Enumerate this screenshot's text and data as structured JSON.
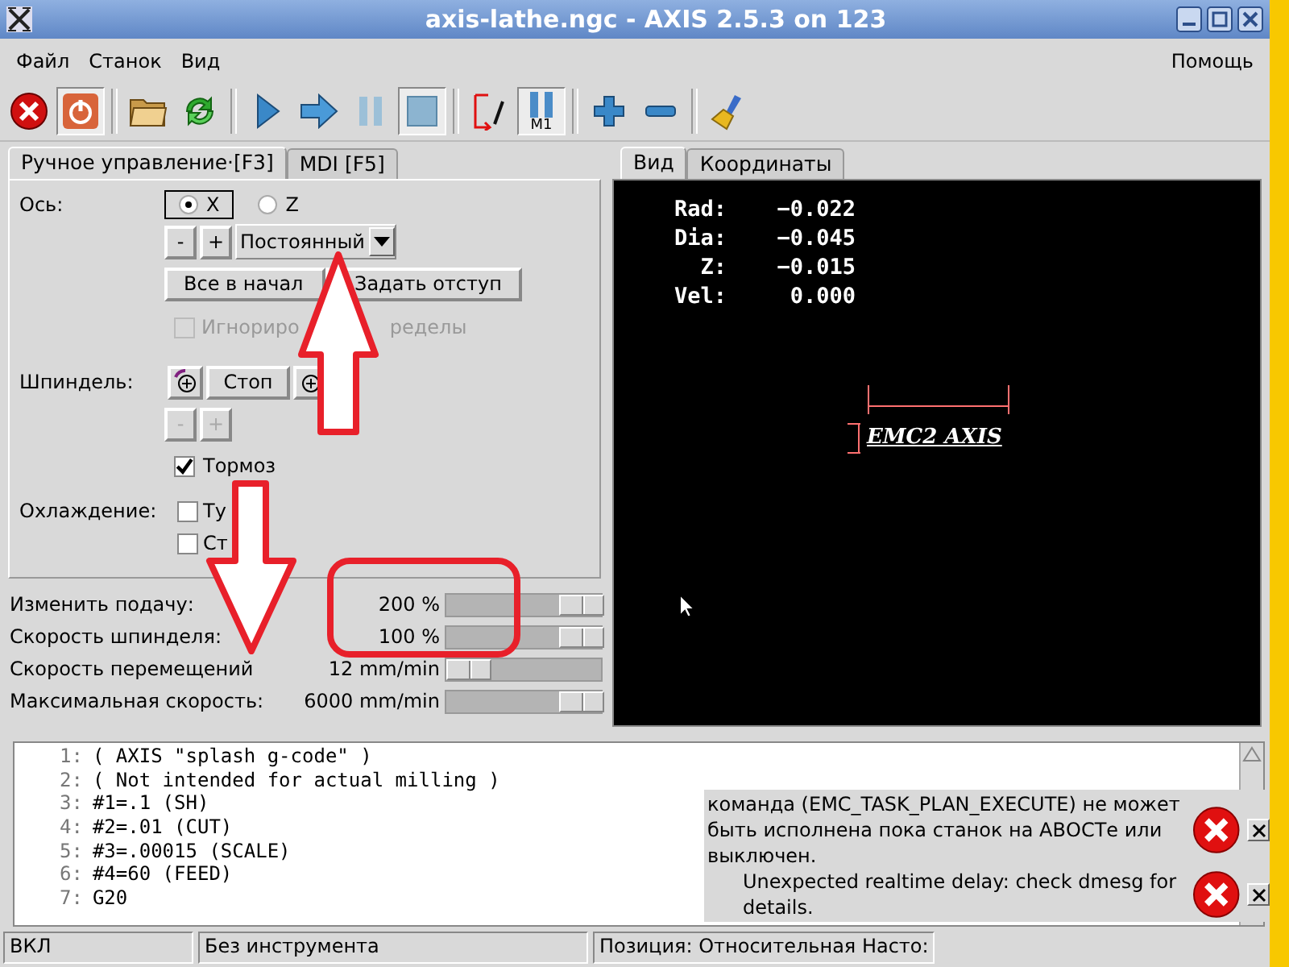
{
  "window": {
    "title": "axis-lathe.ngc - AXIS 2.5.3 on 123"
  },
  "menu": [
    {
      "label": "Файл"
    },
    {
      "label": "Станок"
    },
    {
      "label": "Вид"
    }
  ],
  "help_menu": "Помощь",
  "toolbar": [
    {
      "kind": "estop",
      "pressed": false
    },
    {
      "kind": "power",
      "pressed": true
    },
    {
      "kind": "sep"
    },
    {
      "kind": "open",
      "pressed": false
    },
    {
      "kind": "reload",
      "pressed": false
    },
    {
      "kind": "sep"
    },
    {
      "kind": "run",
      "pressed": false
    },
    {
      "kind": "step",
      "pressed": false
    },
    {
      "kind": "pause",
      "pressed": false
    },
    {
      "kind": "stop",
      "pressed": true
    },
    {
      "kind": "sep"
    },
    {
      "kind": "block-delete",
      "pressed": false
    },
    {
      "kind": "optional-stop",
      "pressed": true,
      "label": "M1"
    },
    {
      "kind": "sep"
    },
    {
      "kind": "zoom-in",
      "pressed": false
    },
    {
      "kind": "zoom-out",
      "pressed": false
    },
    {
      "kind": "sep"
    },
    {
      "kind": "clear",
      "pressed": false
    }
  ],
  "left_tabs": [
    {
      "label": "Ручное управление·[F3]",
      "selected": true
    },
    {
      "label": "MDI [F5]",
      "selected": false
    }
  ],
  "manual": {
    "axis_label": "Ось:",
    "axes": [
      {
        "label": "X",
        "selected": true
      },
      {
        "label": "Z",
        "selected": false
      }
    ],
    "jog_minus": "-",
    "jog_plus": "+",
    "jog_mode": "Постоянный",
    "home_button": "Все в начал",
    "offset_button": "Задать отступ",
    "ignore_limits": {
      "parts": [
        "Игнориро",
        "ределы"
      ],
      "checked": false,
      "disabled": true
    },
    "spindle_label": "Шпиндель:",
    "spindle_stop": "Стоп",
    "spindle_minus": "-",
    "spindle_plus": "+",
    "spindle_adjust_disabled": true,
    "brake": {
      "label": "Тормоз",
      "checked": true
    },
    "coolant_label": "Охлаждение:",
    "coolant": [
      {
        "label": "Ту",
        "checked": false
      },
      {
        "label": "Ст",
        "checked": false
      }
    ]
  },
  "sliders": [
    {
      "label": "Изменить подачу:",
      "reading": "200 %",
      "level": 1
    },
    {
      "label": "Скорость шпинделя:",
      "reading": "100 %",
      "level": 1
    },
    {
      "label": "Скорость перемещений",
      "reading": "12 mm/min",
      "level": 0
    },
    {
      "label": "Максимальная скорость:",
      "reading": "6000 mm/min",
      "level": 1
    }
  ],
  "view_tabs": [
    {
      "label": "Вид",
      "selected": true
    },
    {
      "label": "Координаты",
      "selected": false
    }
  ],
  "dro": [
    {
      "label": "Rad:",
      "value": "−0.022"
    },
    {
      "label": "Dia:",
      "value": "−0.045"
    },
    {
      "label": "Z:",
      "value": "−0.015"
    },
    {
      "label": "Vel:",
      "value": "0.000"
    }
  ],
  "logo": "EMC2 AXIS",
  "code": [
    {
      "number": "1:",
      "text": "( AXIS \"splash g-code\" )"
    },
    {
      "number": "2:",
      "text": "( Not intended for actual milling )"
    },
    {
      "number": "3:",
      "text": "#1=.1 (SH)"
    },
    {
      "number": "4:",
      "text": "#2=.01 (CUT)"
    },
    {
      "number": "5:",
      "text": "#3=.00015 (SCALE)"
    },
    {
      "number": "6:",
      "text": "#4=60 (FEED)"
    },
    {
      "number": "7:",
      "text": "G20"
    }
  ],
  "notifications": [
    {
      "text": "команда (EMC_TASK_PLAN_EXECUTE) не может быть исполнена пока станок на АВОСТе или выключен.",
      "indent": false
    },
    {
      "text": "Unexpected realtime delay: check dmesg for details.",
      "indent": true
    }
  ],
  "status_bar": [
    "ВКЛ",
    "Без инструмента",
    "Позиция: Относительная Насто:"
  ]
}
